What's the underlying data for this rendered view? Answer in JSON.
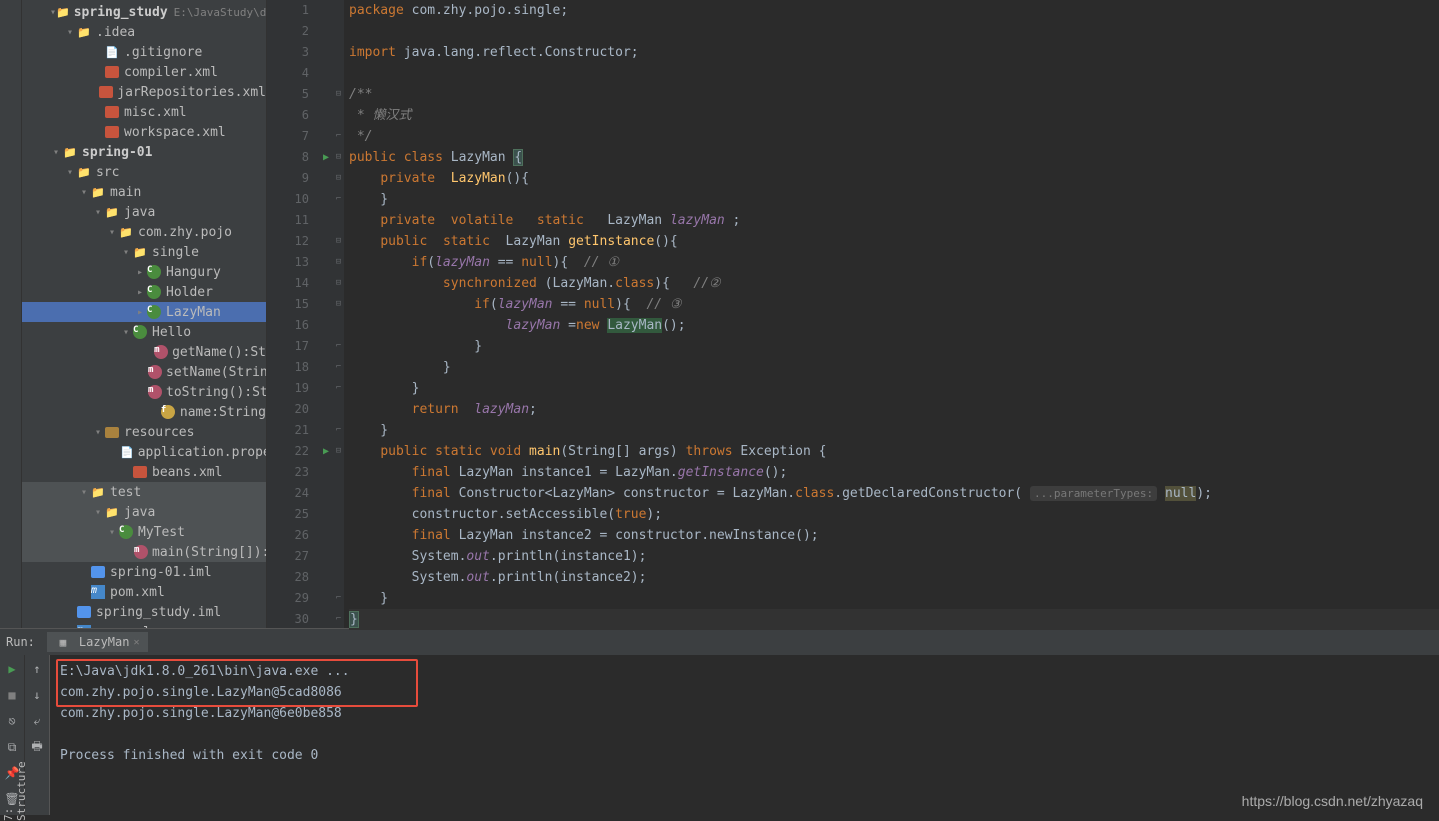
{
  "sidebar": {
    "structure_label": "7: Structure"
  },
  "tree": {
    "items": [
      {
        "indent": 2,
        "arrow": "▾",
        "icon": "folder-blue",
        "label": "spring_study",
        "bold": true,
        "path": "E:\\JavaStudy\\demo\\s"
      },
      {
        "indent": 3,
        "arrow": "▾",
        "icon": "folder",
        "label": ".idea"
      },
      {
        "indent": 5,
        "arrow": "",
        "icon": "file",
        "label": ".gitignore"
      },
      {
        "indent": 5,
        "arrow": "",
        "icon": "xml",
        "label": "compiler.xml"
      },
      {
        "indent": 5,
        "arrow": "",
        "icon": "xml",
        "label": "jarRepositories.xml"
      },
      {
        "indent": 5,
        "arrow": "",
        "icon": "xml",
        "label": "misc.xml"
      },
      {
        "indent": 5,
        "arrow": "",
        "icon": "xml",
        "label": "workspace.xml"
      },
      {
        "indent": 2,
        "arrow": "▾",
        "icon": "folder-blue",
        "label": "spring-01",
        "bold": true
      },
      {
        "indent": 3,
        "arrow": "▾",
        "icon": "folder",
        "label": "src"
      },
      {
        "indent": 4,
        "arrow": "▾",
        "icon": "folder",
        "label": "main"
      },
      {
        "indent": 5,
        "arrow": "▾",
        "icon": "folder-src",
        "label": "java"
      },
      {
        "indent": 6,
        "arrow": "▾",
        "icon": "folder",
        "label": "com.zhy.pojo"
      },
      {
        "indent": 7,
        "arrow": "▾",
        "icon": "folder",
        "label": "single"
      },
      {
        "indent": 8,
        "arrow": "▸",
        "icon": "class-c",
        "label": "Hangury"
      },
      {
        "indent": 8,
        "arrow": "▸",
        "icon": "class-c",
        "label": "Holder"
      },
      {
        "indent": 8,
        "arrow": "▸",
        "icon": "class-c",
        "label": "LazyMan",
        "highlighted": true
      },
      {
        "indent": 7,
        "arrow": "▾",
        "icon": "class-c",
        "label": "Hello"
      },
      {
        "indent": 9,
        "arrow": "",
        "icon": "class-m",
        "label": "getName():St"
      },
      {
        "indent": 9,
        "arrow": "",
        "icon": "class-m",
        "label": "setName(Strin"
      },
      {
        "indent": 9,
        "arrow": "",
        "icon": "class-m",
        "label": "toString():Strin"
      },
      {
        "indent": 9,
        "arrow": "",
        "icon": "class-f",
        "label": "name:String"
      },
      {
        "indent": 5,
        "arrow": "▾",
        "icon": "folder-res",
        "label": "resources"
      },
      {
        "indent": 7,
        "arrow": "",
        "icon": "file",
        "label": "application.properti"
      },
      {
        "indent": 7,
        "arrow": "",
        "icon": "xml",
        "label": "beans.xml"
      },
      {
        "indent": 4,
        "arrow": "▾",
        "icon": "folder",
        "label": "test",
        "dimmed": true
      },
      {
        "indent": 5,
        "arrow": "▾",
        "icon": "folder-src",
        "label": "java",
        "dimmed": true
      },
      {
        "indent": 6,
        "arrow": "▾",
        "icon": "class-c",
        "label": "MyTest",
        "dimmed": true
      },
      {
        "indent": 8,
        "arrow": "",
        "icon": "class-m",
        "label": "main(String[]):vo",
        "dimmed": true
      },
      {
        "indent": 4,
        "arrow": "",
        "icon": "iml",
        "label": "spring-01.iml"
      },
      {
        "indent": 4,
        "arrow": "",
        "icon": "maven-m",
        "label": "pom.xml"
      },
      {
        "indent": 3,
        "arrow": "",
        "icon": "iml",
        "label": "spring_study.iml"
      },
      {
        "indent": 3,
        "arrow": "",
        "icon": "maven-m",
        "label": "pom.xml"
      }
    ]
  },
  "editor": {
    "lines": [
      {
        "n": 1,
        "html": "<span class='kw'>package</span> <span class='pkg'>com.zhy.pojo.single</span>;"
      },
      {
        "n": 2,
        "html": ""
      },
      {
        "n": 3,
        "html": "<span class='kw'>import</span> <span class='pkg'>java.lang.reflect.Constructor</span>;"
      },
      {
        "n": 4,
        "html": ""
      },
      {
        "n": 5,
        "html": "<span class='comment'>/**</span>"
      },
      {
        "n": 6,
        "html": "<span class='comment'> * 懒汉式</span>"
      },
      {
        "n": 7,
        "html": "<span class='comment'> */</span>"
      },
      {
        "n": 8,
        "html": "<span class='kw'>public</span> <span class='kw'>class</span> LazyMan <span class='brace-hl'>{</span>",
        "run": true
      },
      {
        "n": 9,
        "html": "    <span class='kw'>private</span>  <span class='method'>LazyMan</span>(){"
      },
      {
        "n": 10,
        "html": "    }"
      },
      {
        "n": 11,
        "html": "    <span class='kw'>private</span>  <span class='kw'>volatile</span>   <span class='kw'>static</span>   LazyMan <span class='field'>lazyMan</span> ;"
      },
      {
        "n": 12,
        "html": "    <span class='kw'>public</span>  <span class='kw'>static</span>  LazyMan <span class='method'>getInstance</span>(){"
      },
      {
        "n": 13,
        "html": "        <span class='kw'>if</span>(<span class='field'>lazyMan</span> == <span class='kw'>null</span>){  <span class='comment'>// ①</span>"
      },
      {
        "n": 14,
        "html": "            <span class='kw'>synchronized</span> (LazyMan.<span class='kw'>class</span>){   <span class='comment'>//②</span>"
      },
      {
        "n": 15,
        "html": "                <span class='kw'>if</span>(<span class='field'>lazyMan</span> == <span class='kw'>null</span>){  <span class='comment'>// ③</span>"
      },
      {
        "n": 16,
        "html": "                    <span class='field'>lazyMan</span> =<span class='kw'>new</span> <span class='hl-bg'>LazyMan</span>();"
      },
      {
        "n": 17,
        "html": "                }"
      },
      {
        "n": 18,
        "html": "            }"
      },
      {
        "n": 19,
        "html": "        }"
      },
      {
        "n": 20,
        "html": "        <span class='kw'>return</span>  <span class='field'>lazyMan</span>;"
      },
      {
        "n": 21,
        "html": "    }"
      },
      {
        "n": 22,
        "html": "    <span class='kw'>public</span> <span class='kw'>static</span> <span class='kw'>void</span> <span class='method'>main</span>(String[] args) <span class='kw'>throws</span> Exception {",
        "run": true
      },
      {
        "n": 23,
        "html": "        <span class='kw'>final</span> LazyMan instance1 = LazyMan.<span class='field'>getInstance</span>();"
      },
      {
        "n": 24,
        "html": "        <span class='kw'>final</span> Constructor&lt;LazyMan&gt; constructor = LazyMan.<span class='kw'>class</span>.getDeclaredConstructor( <span class='param-hint'>...parameterTypes:</span> <span class='null-hl'>null</span>);"
      },
      {
        "n": 25,
        "html": "        constructor.setAccessible(<span class='kw'>true</span>);"
      },
      {
        "n": 26,
        "html": "        <span class='kw'>final</span> LazyMan instance2 = constructor.newInstance();"
      },
      {
        "n": 27,
        "html": "        System.<span class='field'>out</span>.println(instance1);"
      },
      {
        "n": 28,
        "html": "        System.<span class='field'>out</span>.println(instance2);"
      },
      {
        "n": 29,
        "html": "    }"
      },
      {
        "n": 30,
        "html": "<span class='brace-hl'>}</span>",
        "current": true
      }
    ]
  },
  "run": {
    "label": "Run:",
    "tab_name": "LazyMan",
    "console_lines": [
      "E:\\Java\\jdk1.8.0_261\\bin\\java.exe ...",
      "com.zhy.pojo.single.LazyMan@5cad8086",
      "com.zhy.pojo.single.LazyMan@6e0be858",
      "",
      "Process finished with exit code 0"
    ]
  },
  "watermark": "https://blog.csdn.net/zhyazaq"
}
